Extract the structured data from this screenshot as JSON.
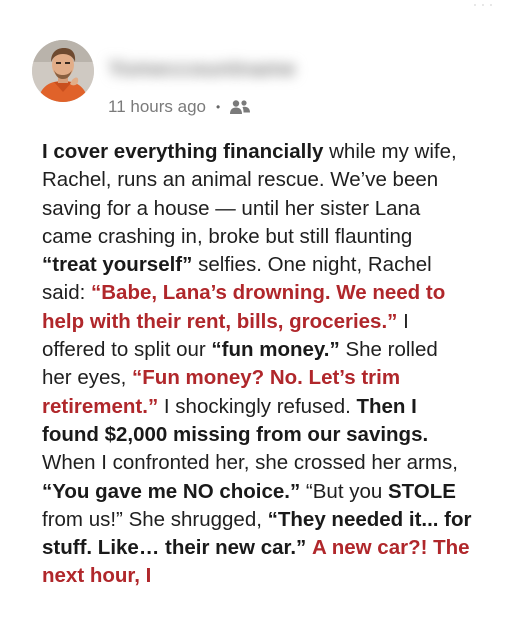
{
  "author": {
    "name": "Yomeccountname",
    "avatar_icon": "avatar-man-orange-shirt"
  },
  "meta": {
    "time": "11 hours ago",
    "separator": "•",
    "audience_icon": "friends-icon"
  },
  "post": {
    "segments": [
      {
        "text": "I cover everything financially",
        "style": "bold"
      },
      {
        "text": " while my wife, Rachel, runs an animal rescue. We’ve been saving for a house — until her sister Lana came crashing in, broke but still flaunting ",
        "style": "normal"
      },
      {
        "text": "“treat yourself”",
        "style": "bold"
      },
      {
        "text": " selfies. One night, Rachel said: ",
        "style": "normal"
      },
      {
        "text": "“Babe, Lana’s drowning. We need to help with their rent, bills, groceries.”",
        "style": "red"
      },
      {
        "text": " I offered to split our ",
        "style": "normal"
      },
      {
        "text": "“fun money.”",
        "style": "bold"
      },
      {
        "text": " She rolled her eyes, ",
        "style": "normal"
      },
      {
        "text": "“Fun money? No. Let’s trim retirement.”",
        "style": "red"
      },
      {
        "text": " I shockingly refused. ",
        "style": "normal"
      },
      {
        "text": "Then I found $2,000 missing from our savings.",
        "style": "bold"
      },
      {
        "text": " When I confronted her, she crossed her arms, ",
        "style": "normal"
      },
      {
        "text": "“You gave me NO choice.”",
        "style": "bold"
      },
      {
        "text": " “But you ",
        "style": "normal"
      },
      {
        "text": "STOLE",
        "style": "bold"
      },
      {
        "text": " from us!” She shrugged, ",
        "style": "normal"
      },
      {
        "text": "“They needed it... for stuff. Like… their new car.”",
        "style": "bold"
      },
      {
        "text": " ",
        "style": "normal"
      },
      {
        "text": "A new car?! The next hour, I",
        "style": "red"
      }
    ]
  },
  "colors": {
    "emphasis_red": "#b0272b",
    "meta_gray": "#7a7a7a",
    "text": "#1f1f1f"
  }
}
